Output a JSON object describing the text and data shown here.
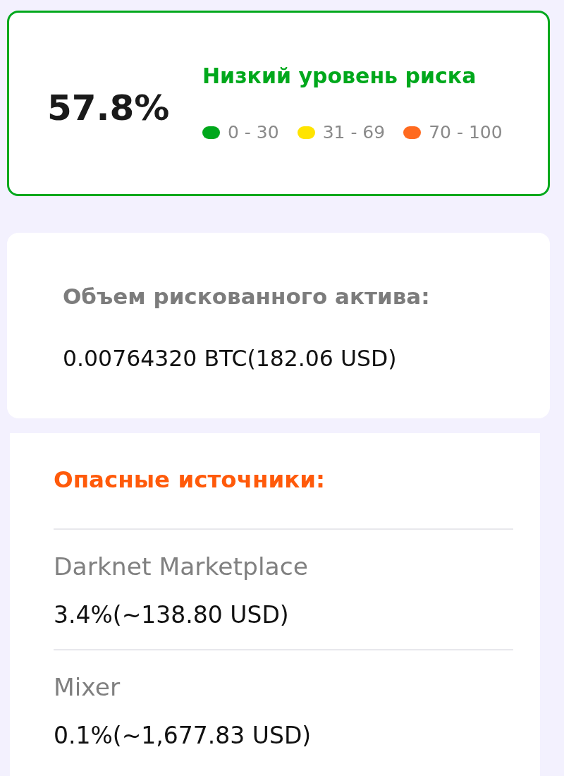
{
  "risk": {
    "score": "57.8%",
    "label": "Низкий уровень риска",
    "color": "#00a81c",
    "legend": [
      {
        "range": "0 - 30",
        "color": "#00a81c"
      },
      {
        "range": "31 - 69",
        "color": "#ffe400"
      },
      {
        "range": "70 - 100",
        "color": "#ff6a1f"
      }
    ]
  },
  "asset": {
    "label": "Объем рискованного актива:",
    "value": "0.00764320 BTC(182.06 USD)"
  },
  "sources": {
    "title": "Опасные источники:",
    "items": [
      {
        "name": "Darknet Marketplace",
        "amount": "3.4%(~138.80 USD)"
      },
      {
        "name": "Mixer",
        "amount": "0.1%(~1,677.83 USD)"
      }
    ]
  }
}
